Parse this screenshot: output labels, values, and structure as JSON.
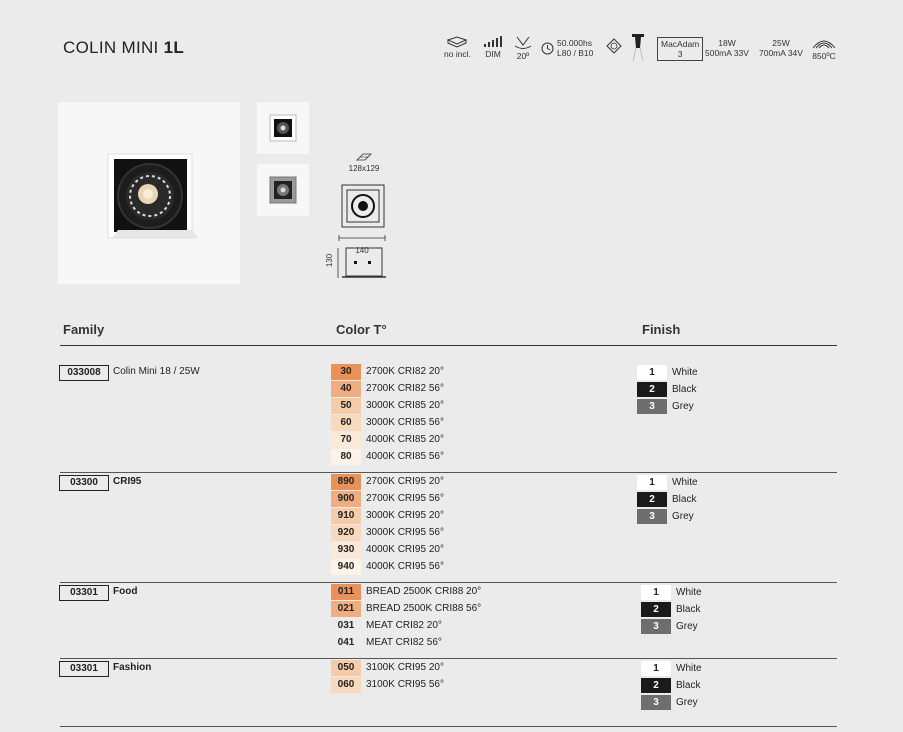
{
  "title": {
    "prefix": "COLIN MINI ",
    "suffix": "1L"
  },
  "specs": {
    "driver": "no incl.",
    "dim": "DIM",
    "angle": "20º",
    "life1": "50.000hs",
    "life2": "L80 / B10",
    "macadam1": "MacAdam",
    "macadam2": "3",
    "p18a": "18W",
    "p18b": "500mA 33V",
    "p25a": "25W",
    "p25b": "700mA 34V",
    "temp": "850ºC"
  },
  "dims": {
    "cutout": "128x129",
    "width": "140",
    "height": "130"
  },
  "headers": {
    "family": "Family",
    "color": "Color T°",
    "finish": "Finish"
  },
  "families": [
    {
      "code": "033008",
      "name": "Colin Mini 18 / 25W",
      "bold": false,
      "colors": [
        {
          "code": "30",
          "desc": "2700K CRI82 20°",
          "bg": "#e8925a"
        },
        {
          "code": "40",
          "desc": "2700K CRI82 56°",
          "bg": "#efad80"
        },
        {
          "code": "50",
          "desc": "3000K CRI85 20°",
          "bg": "#f5cba8"
        },
        {
          "code": "60",
          "desc": "3000K CRI85 56°",
          "bg": "#f8d9bd"
        },
        {
          "code": "70",
          "desc": "4000K CRI85 20°",
          "bg": "#fbe9d8"
        },
        {
          "code": "80",
          "desc": "4000K CRI85 56°",
          "bg": "#fdf3e9"
        }
      ],
      "finishes": [
        {
          "code": "1",
          "label": "White",
          "bg": "#ffffff",
          "fg": "#222222"
        },
        {
          "code": "2",
          "label": "Black",
          "bg": "#1a1a1a",
          "fg": "#ffffff"
        },
        {
          "code": "3",
          "label": "Grey",
          "bg": "#6e6e6e",
          "fg": "#ffffff"
        }
      ]
    },
    {
      "code": "03300",
      "name": "CRI95",
      "bold": true,
      "colors": [
        {
          "code": "890",
          "desc": "2700K CRI95 20°",
          "bg": "#e8925a"
        },
        {
          "code": "900",
          "desc": "2700K CRI95 56°",
          "bg": "#efad80"
        },
        {
          "code": "910",
          "desc": "3000K CRI95 20°",
          "bg": "#f5cba8"
        },
        {
          "code": "920",
          "desc": "3000K CRI95 56°",
          "bg": "#f8d9bd"
        },
        {
          "code": "930",
          "desc": "4000K CRI95 20°",
          "bg": "#fbe9d8"
        },
        {
          "code": "940",
          "desc": "4000K CRI95 56°",
          "bg": "#fdf3e9"
        }
      ],
      "finishes": [
        {
          "code": "1",
          "label": "White",
          "bg": "#ffffff",
          "fg": "#222222"
        },
        {
          "code": "2",
          "label": "Black",
          "bg": "#1a1a1a",
          "fg": "#ffffff"
        },
        {
          "code": "3",
          "label": "Grey",
          "bg": "#6e6e6e",
          "fg": "#ffffff"
        }
      ]
    },
    {
      "code": "03301",
      "name": "Food",
      "bold": true,
      "colors": [
        {
          "code": "011",
          "desc": "BREAD 2500K CRI88 20°",
          "bg": "#e8925a"
        },
        {
          "code": "021",
          "desc": "BREAD 2500K CRI88 56°",
          "bg": "#efad80"
        },
        {
          "code": "031",
          "desc": "MEAT CRI82 20°",
          "bg": "#ebebeb"
        },
        {
          "code": "041",
          "desc": "MEAT CRI82 56°",
          "bg": "#ebebeb"
        }
      ],
      "finishes": [
        {
          "code": "1",
          "label": "White",
          "bg": "#ffffff",
          "fg": "#222222"
        },
        {
          "code": "2",
          "label": "Black",
          "bg": "#1a1a1a",
          "fg": "#ffffff"
        },
        {
          "code": "3",
          "label": "Grey",
          "bg": "#6e6e6e",
          "fg": "#ffffff"
        }
      ]
    },
    {
      "code": "03301",
      "name": "Fashion",
      "bold": true,
      "colors": [
        {
          "code": "050",
          "desc": "3100K CRI95 20°",
          "bg": "#f5cba8"
        },
        {
          "code": "060",
          "desc": "3100K CRI95 56°",
          "bg": "#f8d9bd"
        }
      ],
      "finishes": [
        {
          "code": "1",
          "label": "White",
          "bg": "#ffffff",
          "fg": "#222222"
        },
        {
          "code": "2",
          "label": "Black",
          "bg": "#1a1a1a",
          "fg": "#ffffff"
        },
        {
          "code": "3",
          "label": "Grey",
          "bg": "#6e6e6e",
          "fg": "#ffffff"
        }
      ]
    }
  ]
}
